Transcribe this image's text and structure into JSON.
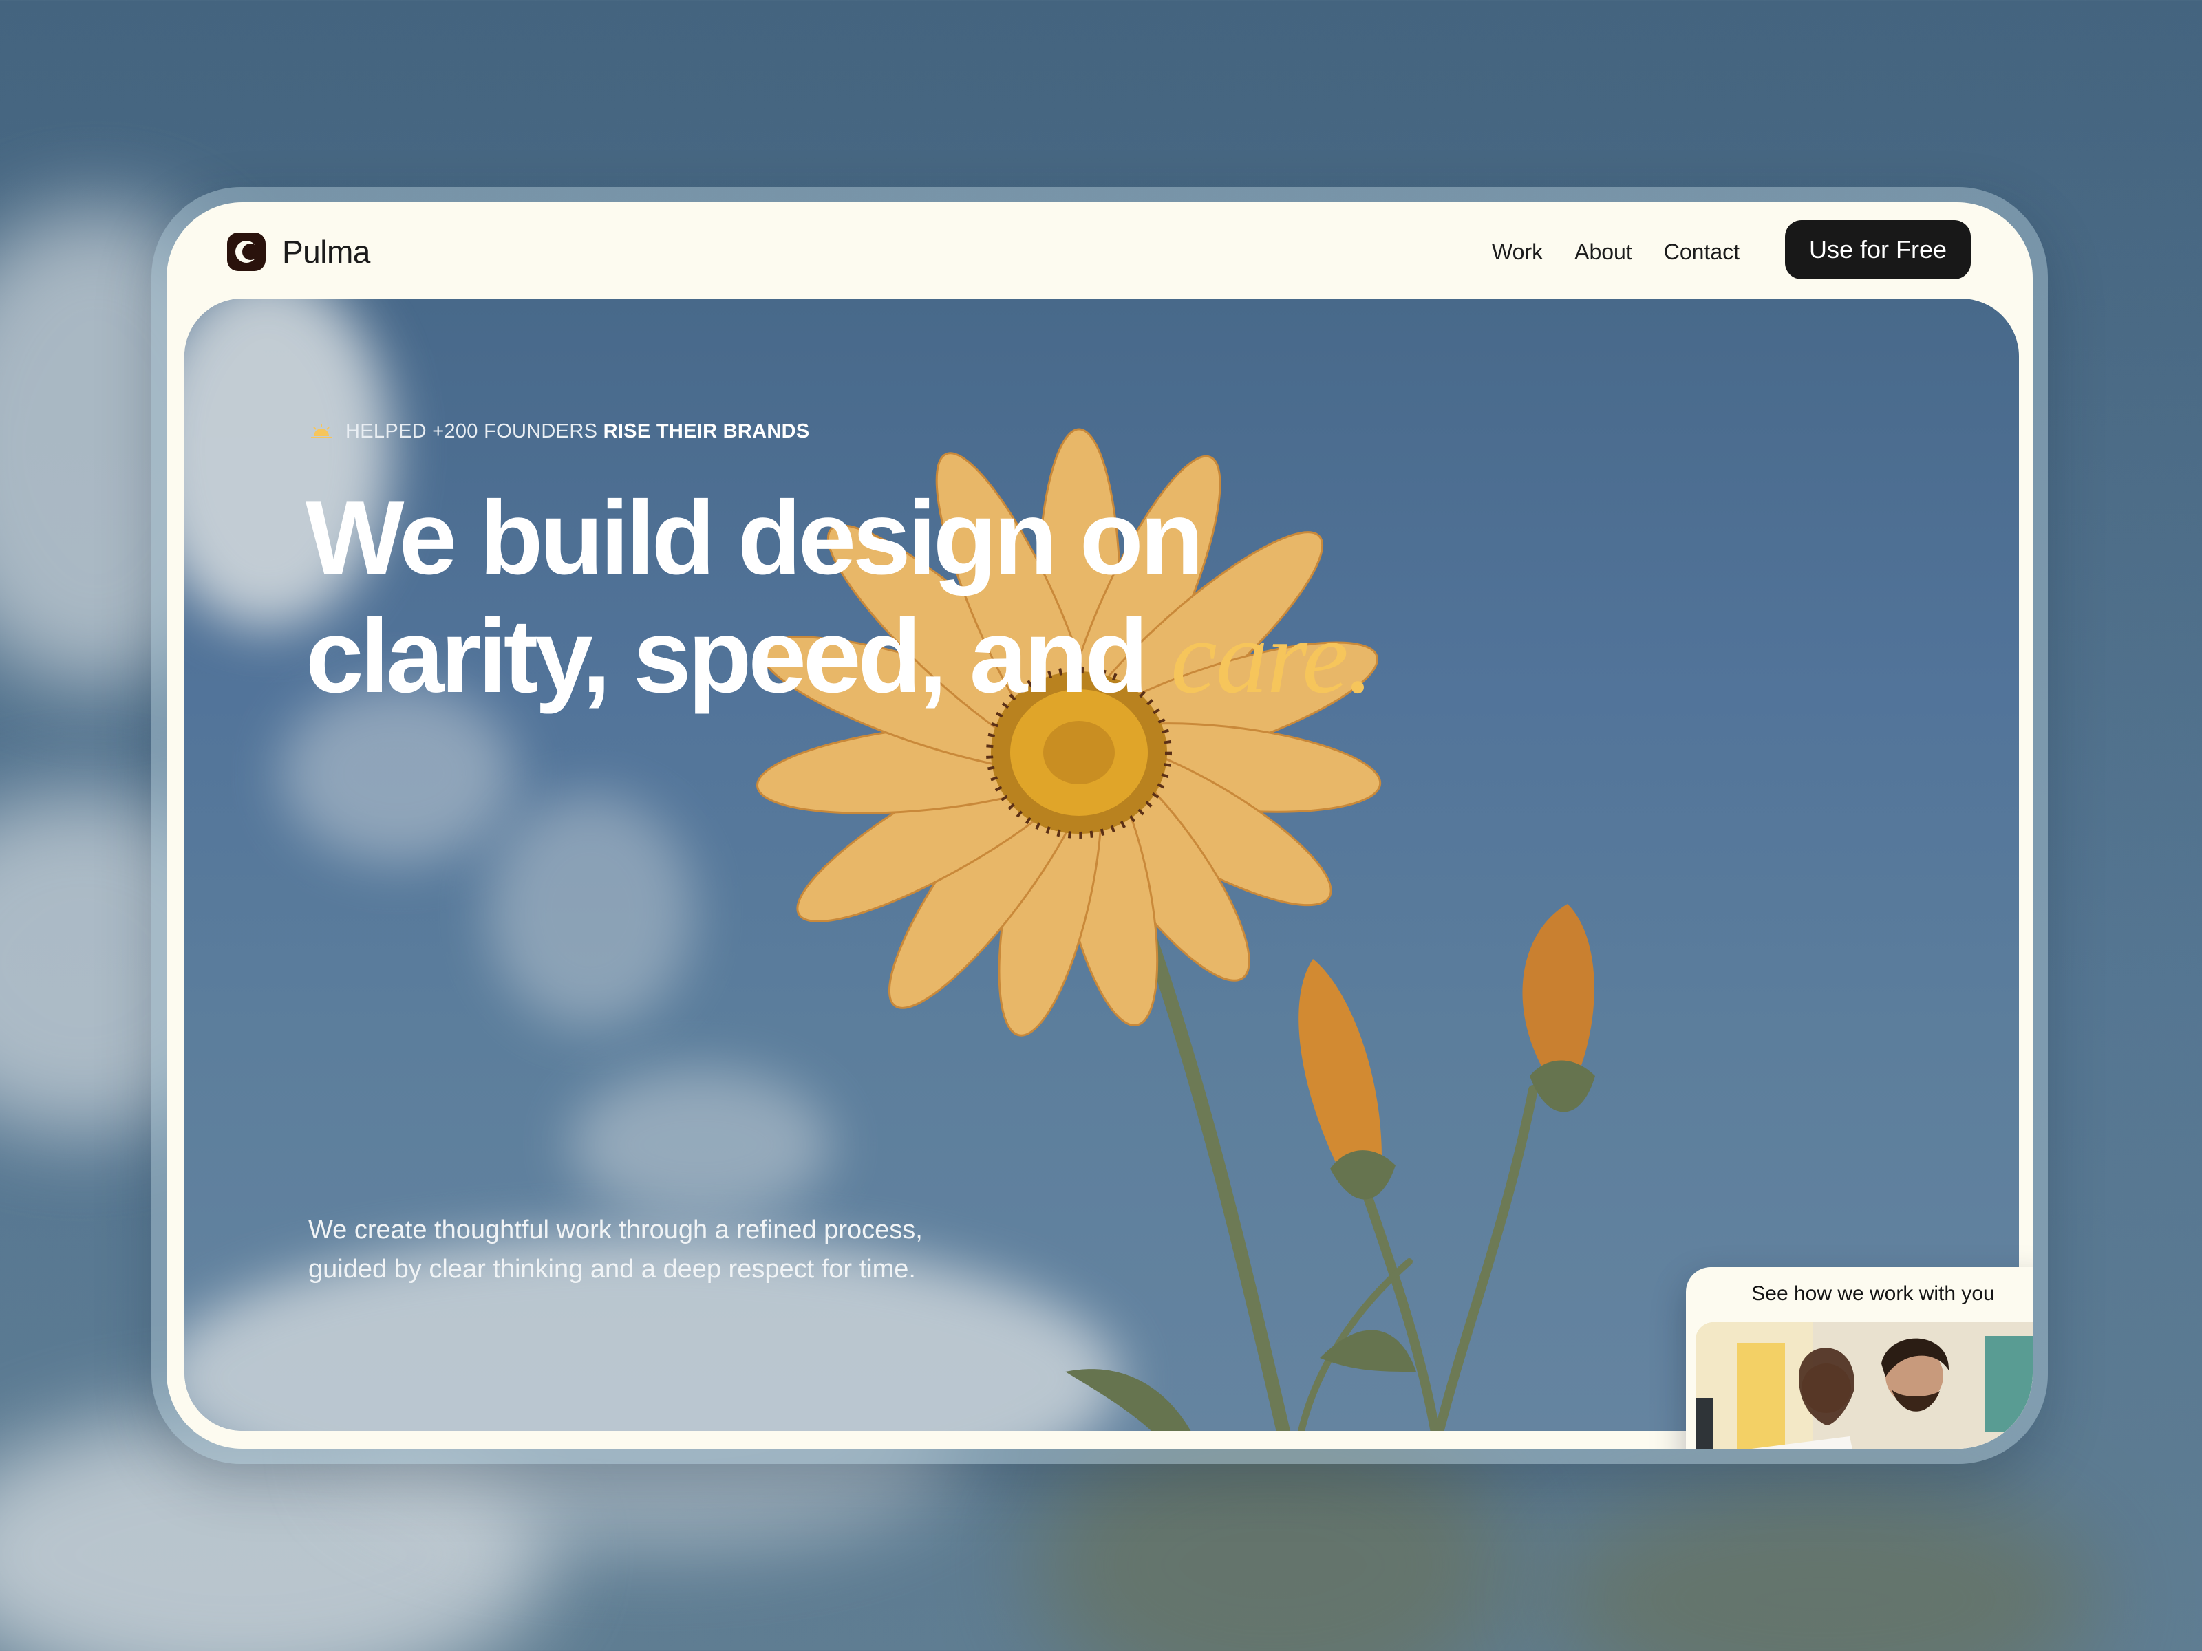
{
  "brand": {
    "name": "Pulma",
    "logo_icon": "pulma-logo-icon"
  },
  "nav": {
    "links": [
      "Work",
      "About",
      "Contact"
    ],
    "cta_label": "Use for Free"
  },
  "hero": {
    "eyebrow_icon": "sun-icon",
    "eyebrow_prefix": "HELPED +200 FOUNDERS",
    "eyebrow_bold": "RISE THEIR BRANDS",
    "headline_line1": "We build design on",
    "headline_line2": "clarity, speed, and",
    "headline_accent": "care.",
    "description": "We create thoughtful work through a refined process, guided by clear thinking and a deep respect for time."
  },
  "video_card": {
    "title": "See how we work with you"
  },
  "colors": {
    "accent": "#f6c55b",
    "cream": "#fdfbf0",
    "cta_bg": "#181818",
    "sky": "#52749a"
  }
}
